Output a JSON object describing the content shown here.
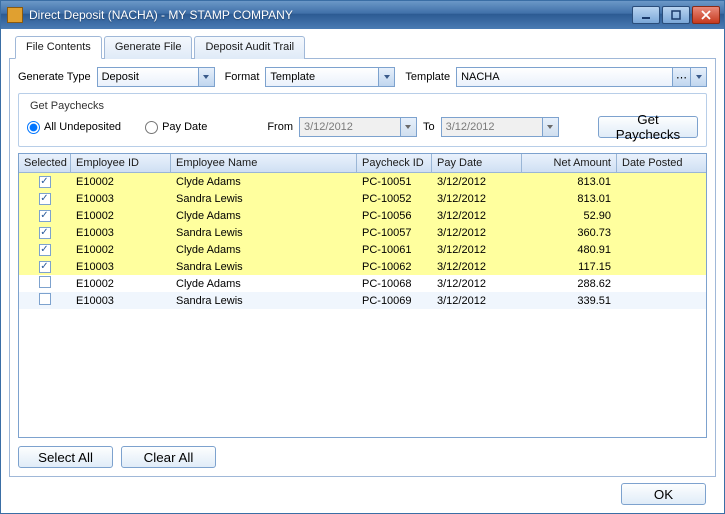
{
  "window": {
    "title": "Direct Deposit (NACHA) - MY STAMP COMPANY"
  },
  "tabs": [
    {
      "label": "File Contents"
    },
    {
      "label": "Generate File"
    },
    {
      "label": "Deposit Audit Trail"
    }
  ],
  "generate": {
    "type_label": "Generate Type",
    "type_value": "Deposit",
    "format_label": "Format",
    "format_value": "Template",
    "template_label": "Template",
    "template_value": "NACHA"
  },
  "paychecks_box": {
    "legend": "Get Paychecks",
    "opt_undeposited": "All Undeposited",
    "opt_paydate": "Pay Date",
    "from_label": "From",
    "from_value": "3/12/2012",
    "to_label": "To",
    "to_value": "3/12/2012",
    "button": "Get Paychecks"
  },
  "grid": {
    "headers": [
      "Selected",
      "Employee ID",
      "Employee Name",
      "Paycheck ID",
      "Pay Date",
      "Net Amount",
      "Date Posted"
    ],
    "rows": [
      {
        "sel": true,
        "emp": "E10002",
        "name": "Clyde Adams",
        "pc": "PC-10051",
        "date": "3/12/2012",
        "amt": "813.01",
        "posted": ""
      },
      {
        "sel": true,
        "emp": "E10003",
        "name": "Sandra Lewis",
        "pc": "PC-10052",
        "date": "3/12/2012",
        "amt": "813.01",
        "posted": ""
      },
      {
        "sel": true,
        "emp": "E10002",
        "name": "Clyde Adams",
        "pc": "PC-10056",
        "date": "3/12/2012",
        "amt": "52.90",
        "posted": ""
      },
      {
        "sel": true,
        "emp": "E10003",
        "name": "Sandra Lewis",
        "pc": "PC-10057",
        "date": "3/12/2012",
        "amt": "360.73",
        "posted": ""
      },
      {
        "sel": true,
        "emp": "E10002",
        "name": "Clyde Adams",
        "pc": "PC-10061",
        "date": "3/12/2012",
        "amt": "480.91",
        "posted": ""
      },
      {
        "sel": true,
        "emp": "E10003",
        "name": "Sandra Lewis",
        "pc": "PC-10062",
        "date": "3/12/2012",
        "amt": "117.15",
        "posted": ""
      },
      {
        "sel": false,
        "emp": "E10002",
        "name": "Clyde Adams",
        "pc": "PC-10068",
        "date": "3/12/2012",
        "amt": "288.62",
        "posted": ""
      },
      {
        "sel": false,
        "emp": "E10003",
        "name": "Sandra Lewis",
        "pc": "PC-10069",
        "date": "3/12/2012",
        "amt": "339.51",
        "posted": ""
      }
    ]
  },
  "buttons": {
    "select_all": "Select All",
    "clear_all": "Clear All",
    "ok": "OK"
  }
}
